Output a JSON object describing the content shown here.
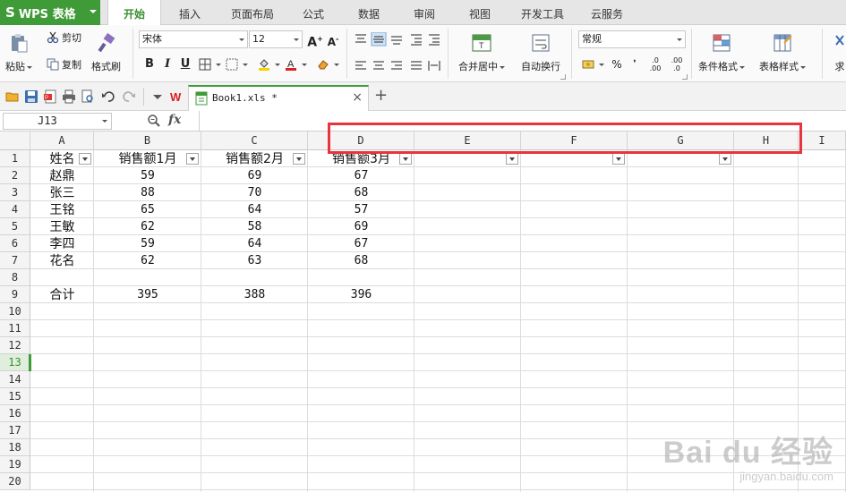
{
  "app": {
    "logo_mark": "S",
    "title": "WPS 表格"
  },
  "menu": {
    "tabs": [
      "开始",
      "插入",
      "页面布局",
      "公式",
      "数据",
      "审阅",
      "视图",
      "开发工具",
      "云服务"
    ],
    "active": "开始"
  },
  "ribbon": {
    "paste": "粘贴",
    "cut": "剪切",
    "copy": "复制",
    "format_painter": "格式刷",
    "font_name": "宋体",
    "font_size": "12",
    "bold": "B",
    "italic": "I",
    "underline": "U",
    "merge_center": "合并居中",
    "wrap_text": "自动换行",
    "number_format": "常规",
    "percent": "%",
    "comma": "❜",
    "inc_decimal": ".00",
    "dec_decimal": ".0",
    "conditional_format": "条件格式",
    "table_style": "表格样式",
    "sum_cut": "求"
  },
  "doc": {
    "tab_name": "Book1.xls *",
    "close": "×",
    "new_tab": "+"
  },
  "formula_bar": {
    "name_box": "J13",
    "fx": "fx",
    "value": ""
  },
  "sheet": {
    "columns": [
      "A",
      "B",
      "C",
      "D",
      "E",
      "F",
      "G",
      "H",
      "I"
    ],
    "rows": [
      "1",
      "2",
      "3",
      "4",
      "5",
      "6",
      "7",
      "8",
      "9",
      "10",
      "11",
      "12",
      "13",
      "14",
      "15",
      "16",
      "17",
      "18",
      "19",
      "20"
    ],
    "selected_row": "13",
    "header_row": [
      "姓名",
      "销售额1月",
      "销售额2月",
      "销售额3月"
    ],
    "data": [
      {
        "name": "赵鼎",
        "m1": "59",
        "m2": "69",
        "m3": "67"
      },
      {
        "name": "张三",
        "m1": "88",
        "m2": "70",
        "m3": "68"
      },
      {
        "name": "王铭",
        "m1": "65",
        "m2": "64",
        "m3": "57"
      },
      {
        "name": "王敏",
        "m1": "62",
        "m2": "58",
        "m3": "69"
      },
      {
        "name": "李四",
        "m1": "59",
        "m2": "64",
        "m3": "67"
      },
      {
        "name": "花名",
        "m1": "62",
        "m2": "63",
        "m3": "68"
      }
    ],
    "total": {
      "label": "合计",
      "m1": "395",
      "m2": "388",
      "m3": "396"
    }
  },
  "colors": {
    "brand": "#3f9b37",
    "highlight_box": "#e8343c"
  },
  "watermark": {
    "main": "Bai du 经验",
    "sub": "jingyan.baidu.com"
  }
}
